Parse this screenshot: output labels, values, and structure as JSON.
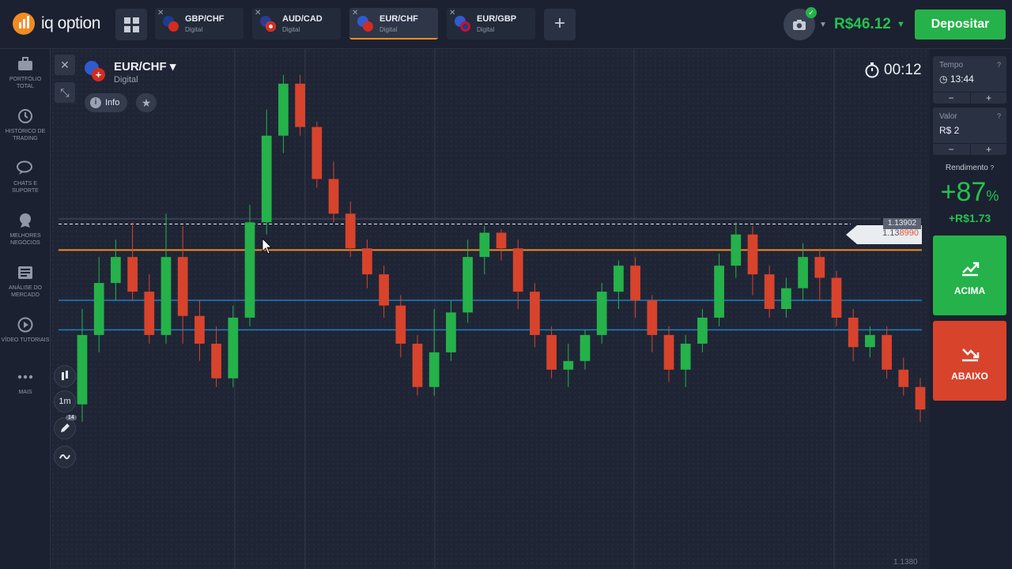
{
  "brand": {
    "name": "iq option"
  },
  "tabs": [
    {
      "pair": "GBP/CHF",
      "type": "Digital",
      "flag1": "#c8102e",
      "flag2": "#d52b1e",
      "active": false
    },
    {
      "pair": "AUD/CAD",
      "type": "Digital",
      "flag1": "#2a3d8f",
      "flag2": "#d52b1e",
      "active": false
    },
    {
      "pair": "EUR/CHF",
      "type": "Digital",
      "flag1": "#2e5bd0",
      "flag2": "#d52b1e",
      "active": true
    },
    {
      "pair": "EUR/GBP",
      "type": "Digital",
      "flag1": "#2e5bd0",
      "flag2": "#c8102e",
      "active": false
    }
  ],
  "header": {
    "balance": "R$46.12",
    "deposit_label": "Depositar"
  },
  "sidebar": {
    "items": [
      {
        "label": "PORTFÓLIO TOTAL",
        "icon": "briefcase-icon"
      },
      {
        "label": "HISTÓRICO DE TRADING",
        "icon": "history-icon"
      },
      {
        "label": "CHATS E SUPORTE",
        "icon": "chat-icon"
      },
      {
        "label": "MELHORES NEGÓCIOS",
        "icon": "trophy-icon"
      },
      {
        "label": "ANÁLISE DO MERCADO",
        "icon": "news-icon"
      },
      {
        "label": "VÍDEO TUTORIAIS",
        "icon": "play-icon"
      },
      {
        "label": "MAIS",
        "icon": "more-icon"
      }
    ]
  },
  "asset": {
    "name": "EUR/CHF",
    "type": "Digital",
    "info_label": "Info"
  },
  "chart_tools": {
    "timeframe": "1m",
    "drawings_badge": "14"
  },
  "timer": "00:12",
  "price": {
    "high_label": "1.13902",
    "current_prefix": "1.13",
    "current_suffix": "8990",
    "axis_label": "1.1380"
  },
  "panel": {
    "time_label": "Tempo",
    "time_value": "13:44",
    "amount_label": "Valor",
    "amount_value": "R$ 2",
    "yield_label": "Rendimento",
    "yield_sign": "+",
    "yield_value": "87",
    "yield_unit": "%",
    "yield_amount": "+R$1.73",
    "up_label": "ACIMA",
    "down_label": "ABAIXO"
  },
  "colors": {
    "up": "#25b24a",
    "down": "#d8432c",
    "accent": "#f28b22",
    "line_blue": "#1f7fc4"
  },
  "chart_data": {
    "type": "candlestick",
    "series": [
      {
        "o": 1.13795,
        "c": 1.13835,
        "h": 1.1385,
        "l": 1.13785
      },
      {
        "o": 1.13835,
        "c": 1.13865,
        "h": 1.1388,
        "l": 1.13825
      },
      {
        "o": 1.13865,
        "c": 1.1388,
        "h": 1.1389,
        "l": 1.13855
      },
      {
        "o": 1.1388,
        "c": 1.1386,
        "h": 1.139,
        "l": 1.13855
      },
      {
        "o": 1.1386,
        "c": 1.13835,
        "h": 1.1387,
        "l": 1.1383
      },
      {
        "o": 1.13835,
        "c": 1.1388,
        "h": 1.13905,
        "l": 1.1383
      },
      {
        "o": 1.1388,
        "c": 1.13846,
        "h": 1.13898,
        "l": 1.1383
      },
      {
        "o": 1.13846,
        "c": 1.1383,
        "h": 1.13855,
        "l": 1.1382
      },
      {
        "o": 1.1383,
        "c": 1.1381,
        "h": 1.1384,
        "l": 1.13805
      },
      {
        "o": 1.1381,
        "c": 1.13845,
        "h": 1.13852,
        "l": 1.13805
      },
      {
        "o": 1.13845,
        "c": 1.139,
        "h": 1.1391,
        "l": 1.1384
      },
      {
        "o": 1.139,
        "c": 1.1395,
        "h": 1.13965,
        "l": 1.13893
      },
      {
        "o": 1.1395,
        "c": 1.1398,
        "h": 1.13985,
        "l": 1.1394
      },
      {
        "o": 1.1398,
        "c": 1.13955,
        "h": 1.13985,
        "l": 1.1395
      },
      {
        "o": 1.13955,
        "c": 1.13925,
        "h": 1.13958,
        "l": 1.1392
      },
      {
        "o": 1.13925,
        "c": 1.13905,
        "h": 1.13935,
        "l": 1.139
      },
      {
        "o": 1.13905,
        "c": 1.13885,
        "h": 1.13912,
        "l": 1.1388
      },
      {
        "o": 1.13885,
        "c": 1.1387,
        "h": 1.1389,
        "l": 1.13862
      },
      {
        "o": 1.1387,
        "c": 1.13852,
        "h": 1.13875,
        "l": 1.13845
      },
      {
        "o": 1.13852,
        "c": 1.1383,
        "h": 1.13858,
        "l": 1.13822
      },
      {
        "o": 1.1383,
        "c": 1.13805,
        "h": 1.13835,
        "l": 1.138
      },
      {
        "o": 1.13805,
        "c": 1.13825,
        "h": 1.1385,
        "l": 1.138
      },
      {
        "o": 1.13825,
        "c": 1.13848,
        "h": 1.13855,
        "l": 1.1382
      },
      {
        "o": 1.13848,
        "c": 1.1388,
        "h": 1.1389,
        "l": 1.13842
      },
      {
        "o": 1.1388,
        "c": 1.13894,
        "h": 1.13898,
        "l": 1.1387
      },
      {
        "o": 1.13894,
        "c": 1.13885,
        "h": 1.13896,
        "l": 1.13878
      },
      {
        "o": 1.13885,
        "c": 1.1386,
        "h": 1.1389,
        "l": 1.1385
      },
      {
        "o": 1.1386,
        "c": 1.13835,
        "h": 1.13865,
        "l": 1.13828
      },
      {
        "o": 1.13835,
        "c": 1.13815,
        "h": 1.1384,
        "l": 1.1381
      },
      {
        "o": 1.13815,
        "c": 1.1382,
        "h": 1.1383,
        "l": 1.13805
      },
      {
        "o": 1.1382,
        "c": 1.13835,
        "h": 1.13838,
        "l": 1.13815
      },
      {
        "o": 1.13835,
        "c": 1.1386,
        "h": 1.13865,
        "l": 1.1383
      },
      {
        "o": 1.1386,
        "c": 1.13875,
        "h": 1.13878,
        "l": 1.1385
      },
      {
        "o": 1.13875,
        "c": 1.13855,
        "h": 1.1388,
        "l": 1.13845
      },
      {
        "o": 1.13855,
        "c": 1.13835,
        "h": 1.13858,
        "l": 1.13825
      },
      {
        "o": 1.13835,
        "c": 1.13815,
        "h": 1.1384,
        "l": 1.13808
      },
      {
        "o": 1.13815,
        "c": 1.1383,
        "h": 1.13835,
        "l": 1.13805
      },
      {
        "o": 1.1383,
        "c": 1.13845,
        "h": 1.1385,
        "l": 1.13825
      },
      {
        "o": 1.13845,
        "c": 1.13875,
        "h": 1.13882,
        "l": 1.1384
      },
      {
        "o": 1.13875,
        "c": 1.13893,
        "h": 1.139,
        "l": 1.13868
      },
      {
        "o": 1.13893,
        "c": 1.1387,
        "h": 1.13898,
        "l": 1.13858
      },
      {
        "o": 1.1387,
        "c": 1.1385,
        "h": 1.13875,
        "l": 1.13845
      },
      {
        "o": 1.1385,
        "c": 1.13862,
        "h": 1.13868,
        "l": 1.13845
      },
      {
        "o": 1.13862,
        "c": 1.1388,
        "h": 1.13888,
        "l": 1.13855
      },
      {
        "o": 1.1388,
        "c": 1.13868,
        "h": 1.13885,
        "l": 1.13855
      },
      {
        "o": 1.13868,
        "c": 1.13845,
        "h": 1.13872,
        "l": 1.1384
      },
      {
        "o": 1.13845,
        "c": 1.13828,
        "h": 1.1385,
        "l": 1.1382
      },
      {
        "o": 1.13828,
        "c": 1.13835,
        "h": 1.1384,
        "l": 1.13822
      },
      {
        "o": 1.13835,
        "c": 1.13815,
        "h": 1.1384,
        "l": 1.1381
      },
      {
        "o": 1.13815,
        "c": 1.13805,
        "h": 1.13822,
        "l": 1.138
      },
      {
        "o": 1.13805,
        "c": 1.13792,
        "h": 1.1381,
        "l": 1.13785
      }
    ],
    "levels": [
      1.13902,
      1.13899,
      1.13884,
      1.13855,
      1.13838
    ]
  }
}
